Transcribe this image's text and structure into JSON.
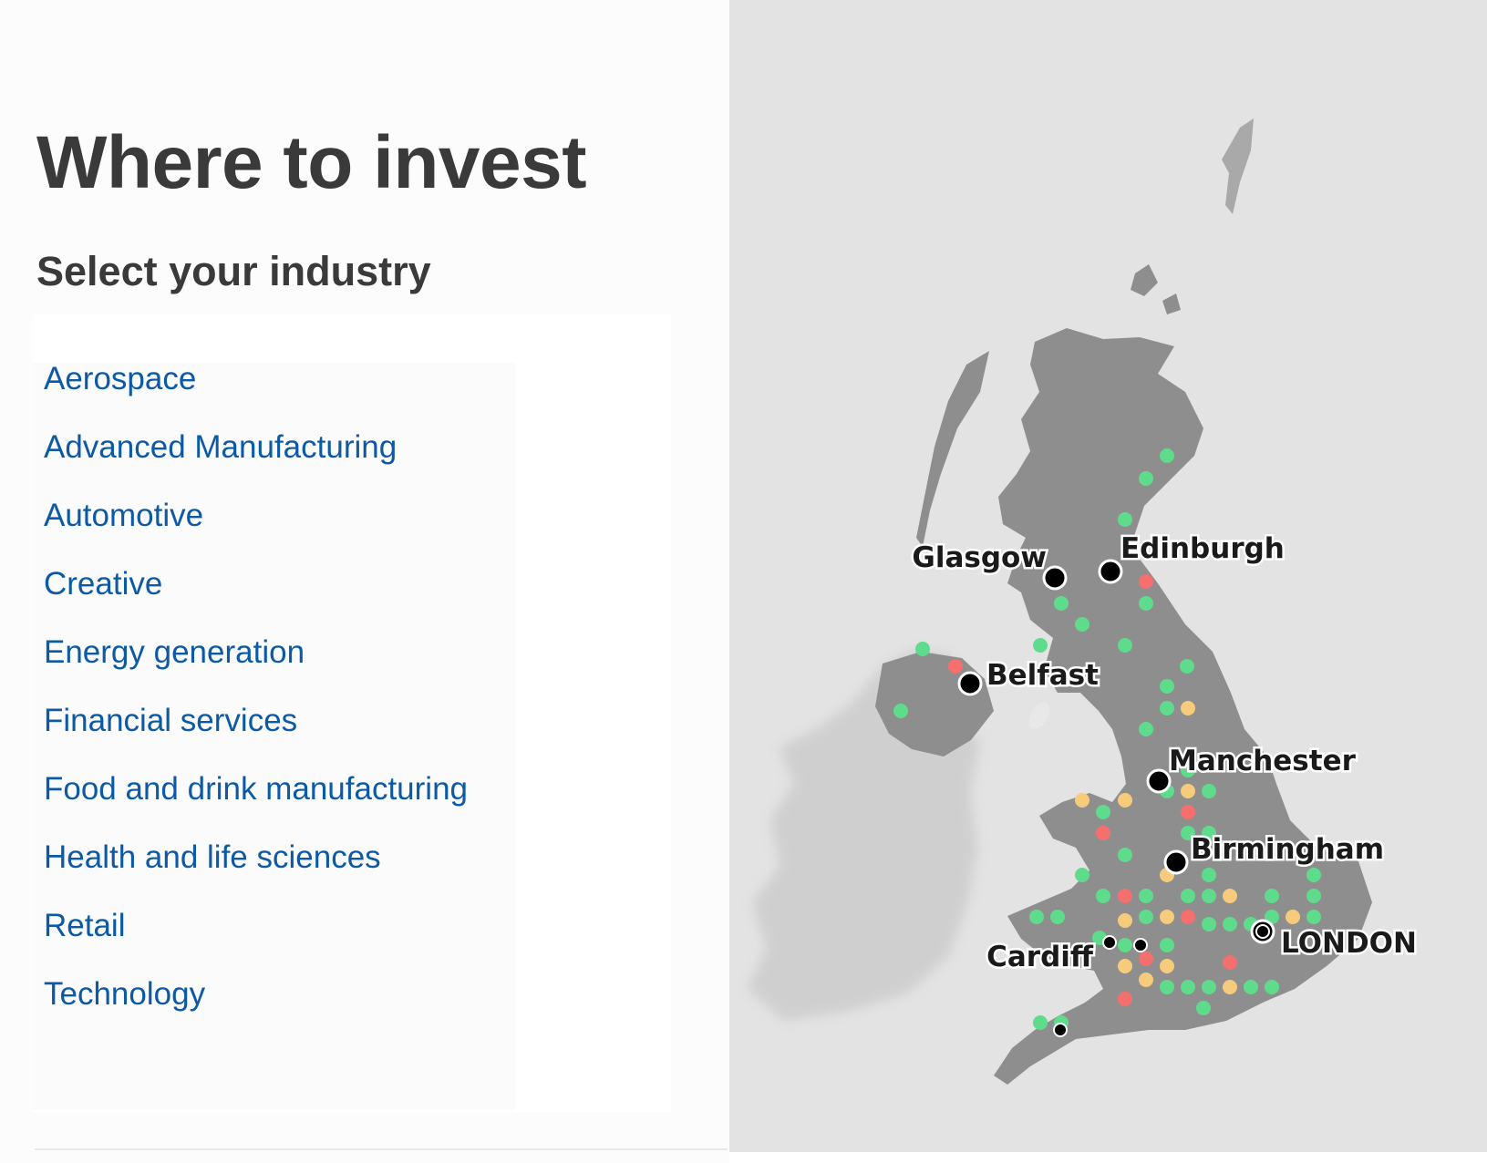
{
  "page": {
    "title": "Where to invest",
    "subtitle": "Select your industry"
  },
  "industries": [
    {
      "label": "Aerospace"
    },
    {
      "label": "Advanced Manufacturing"
    },
    {
      "label": "Automotive"
    },
    {
      "label": "Creative"
    },
    {
      "label": "Energy generation"
    },
    {
      "label": "Financial services"
    },
    {
      "label": "Food and drink manufacturing"
    },
    {
      "label": "Health and life sciences"
    },
    {
      "label": "Retail"
    },
    {
      "label": "Technology"
    }
  ],
  "map": {
    "colors": {
      "land_main": "#8e8e8e",
      "land_ireland": "#c9c9c9",
      "sea": "#e3e3e3",
      "dot_green": "#5fdc8b",
      "dot_amber": "#f7cb7c",
      "dot_red": "#f56f6f",
      "city_marker": "#000000"
    },
    "cities": [
      {
        "name": "Glasgow",
        "icon": "city-dot-icon"
      },
      {
        "name": "Edinburgh",
        "icon": "city-dot-icon"
      },
      {
        "name": "Belfast",
        "icon": "city-dot-icon"
      },
      {
        "name": "Manchester",
        "icon": "city-dot-icon"
      },
      {
        "name": "Birmingham",
        "icon": "city-dot-icon"
      },
      {
        "name": "Cardiff",
        "icon": "city-dot-icon"
      },
      {
        "name": "LONDON",
        "icon": "capital-target-icon"
      }
    ]
  }
}
